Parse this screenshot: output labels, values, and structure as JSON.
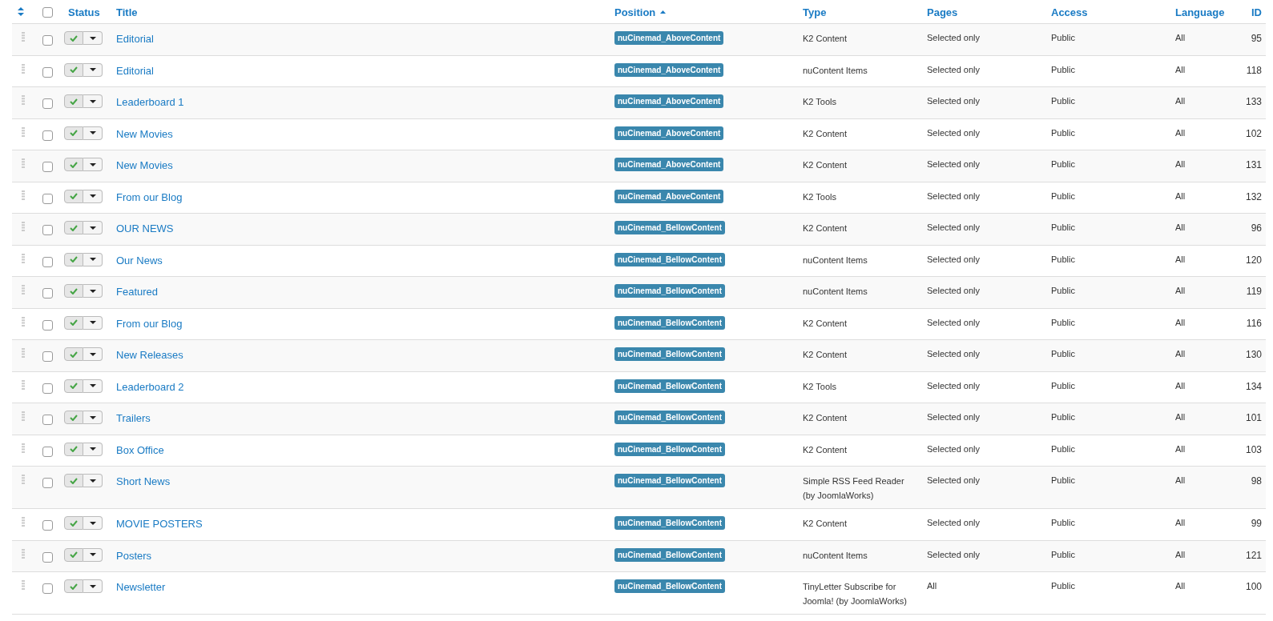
{
  "table": {
    "columns": [
      {
        "label": "Status",
        "sorted": false
      },
      {
        "label": "Title",
        "sorted": false
      },
      {
        "label": "Position",
        "sorted": true
      },
      {
        "label": "Type",
        "sorted": false
      },
      {
        "label": "Pages",
        "sorted": false
      },
      {
        "label": "Access",
        "sorted": false
      },
      {
        "label": "Language",
        "sorted": false
      },
      {
        "label": "ID",
        "sorted": false
      }
    ],
    "select_all": {
      "checked": false
    },
    "rows": [
      {
        "checked": false,
        "published": true,
        "title": "Editorial",
        "position": "nuCinemad_AboveContent",
        "type": "K2 Content",
        "pages": "Selected only",
        "access": "Public",
        "language": "All",
        "id": "95"
      },
      {
        "checked": false,
        "published": true,
        "title": "Editorial",
        "position": "nuCinemad_AboveContent",
        "type": "nuContent Items",
        "pages": "Selected only",
        "access": "Public",
        "language": "All",
        "id": "118"
      },
      {
        "checked": false,
        "published": true,
        "title": "Leaderboard 1",
        "position": "nuCinemad_AboveContent",
        "type": "K2 Tools",
        "pages": "Selected only",
        "access": "Public",
        "language": "All",
        "id": "133"
      },
      {
        "checked": false,
        "published": true,
        "title": "New Movies",
        "position": "nuCinemad_AboveContent",
        "type": "K2 Content",
        "pages": "Selected only",
        "access": "Public",
        "language": "All",
        "id": "102"
      },
      {
        "checked": false,
        "published": true,
        "title": "New Movies",
        "position": "nuCinemad_AboveContent",
        "type": "K2 Content",
        "pages": "Selected only",
        "access": "Public",
        "language": "All",
        "id": "131"
      },
      {
        "checked": false,
        "published": true,
        "title": "From our Blog",
        "position": "nuCinemad_AboveContent",
        "type": "K2 Tools",
        "pages": "Selected only",
        "access": "Public",
        "language": "All",
        "id": "132"
      },
      {
        "checked": false,
        "published": true,
        "title": "OUR NEWS",
        "position": "nuCinemad_BellowContent",
        "type": "K2 Content",
        "pages": "Selected only",
        "access": "Public",
        "language": "All",
        "id": "96"
      },
      {
        "checked": false,
        "published": true,
        "title": "Our News",
        "position": "nuCinemad_BellowContent",
        "type": "nuContent Items",
        "pages": "Selected only",
        "access": "Public",
        "language": "All",
        "id": "120"
      },
      {
        "checked": false,
        "published": true,
        "title": "Featured",
        "position": "nuCinemad_BellowContent",
        "type": "nuContent Items",
        "pages": "Selected only",
        "access": "Public",
        "language": "All",
        "id": "119"
      },
      {
        "checked": false,
        "published": true,
        "title": "From our Blog",
        "position": "nuCinemad_BellowContent",
        "type": "K2 Content",
        "pages": "Selected only",
        "access": "Public",
        "language": "All",
        "id": "116"
      },
      {
        "checked": false,
        "published": true,
        "title": "New Releases",
        "position": "nuCinemad_BellowContent",
        "type": "K2 Content",
        "pages": "Selected only",
        "access": "Public",
        "language": "All",
        "id": "130"
      },
      {
        "checked": false,
        "published": true,
        "title": "Leaderboard 2",
        "position": "nuCinemad_BellowContent",
        "type": "K2 Tools",
        "pages": "Selected only",
        "access": "Public",
        "language": "All",
        "id": "134"
      },
      {
        "checked": false,
        "published": true,
        "title": "Trailers",
        "position": "nuCinemad_BellowContent",
        "type": "K2 Content",
        "pages": "Selected only",
        "access": "Public",
        "language": "All",
        "id": "101"
      },
      {
        "checked": false,
        "published": true,
        "title": "Box Office",
        "position": "nuCinemad_BellowContent",
        "type": "K2 Content",
        "pages": "Selected only",
        "access": "Public",
        "language": "All",
        "id": "103"
      },
      {
        "checked": false,
        "published": true,
        "title": "Short News",
        "position": "nuCinemad_BellowContent",
        "type": "Simple RSS Feed Reader (by JoomlaWorks)",
        "pages": "Selected only",
        "access": "Public",
        "language": "All",
        "id": "98"
      },
      {
        "checked": false,
        "published": true,
        "title": "MOVIE POSTERS",
        "position": "nuCinemad_BellowContent",
        "type": "K2 Content",
        "pages": "Selected only",
        "access": "Public",
        "language": "All",
        "id": "99"
      },
      {
        "checked": false,
        "published": true,
        "title": "Posters",
        "position": "nuCinemad_BellowContent",
        "type": "nuContent Items",
        "pages": "Selected only",
        "access": "Public",
        "language": "All",
        "id": "121"
      },
      {
        "checked": false,
        "published": true,
        "title": "Newsletter",
        "position": "nuCinemad_BellowContent",
        "type": "TinyLetter Subscribe for Joomla! (by JoomlaWorks)",
        "pages": "All",
        "access": "Public",
        "language": "All",
        "id": "100"
      }
    ]
  }
}
